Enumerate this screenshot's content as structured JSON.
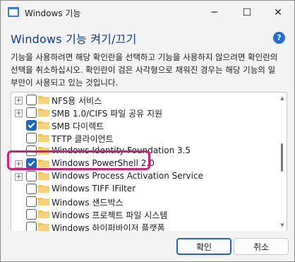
{
  "window": {
    "title": "Windows 기능"
  },
  "panel": {
    "heading": "Windows 기능 켜기/끄기",
    "help_icon_text": "?",
    "description": "기능을 사용하려면 해당 확인란을 선택하고 기능을 사용하지 않으려면 확인란의 선택을 취소하십시오. 확인란이 검은 사각형으로 채워진 경우는 해당 기능의 일부만이 사용되고 있는 것입니다."
  },
  "features": [
    {
      "label": "NFS용 서비스",
      "expandable": true,
      "checked": false
    },
    {
      "label": "SMB 1.0/CIFS 파일 공유 지원",
      "expandable": true,
      "checked": false
    },
    {
      "label": "SMB 다이렉트",
      "expandable": false,
      "checked": true
    },
    {
      "label": "TFTP 클라이언트",
      "expandable": false,
      "checked": false
    },
    {
      "label": "Windows Identity Foundation 3.5",
      "expandable": false,
      "checked": false
    },
    {
      "label": "Windows PowerShell 2.0",
      "expandable": true,
      "checked": true
    },
    {
      "label": "Windows Process Activation Service",
      "expandable": true,
      "checked": false
    },
    {
      "label": "Windows TIFF IFilter",
      "expandable": false,
      "checked": false
    },
    {
      "label": "Windows 샌드박스",
      "expandable": false,
      "checked": false
    },
    {
      "label": "Windows 프로젝트 파일 시스템",
      "expandable": false,
      "checked": false
    },
    {
      "label": "Windows 하이퍼바이저 플랫폼",
      "expandable": false,
      "checked": false
    }
  ],
  "buttons": {
    "ok": "확인",
    "cancel": "취소"
  },
  "colors": {
    "accent": "#1f66c4",
    "heading": "#0b3b8c",
    "highlight": "#d81b7a",
    "folder": "#f2c14e"
  }
}
